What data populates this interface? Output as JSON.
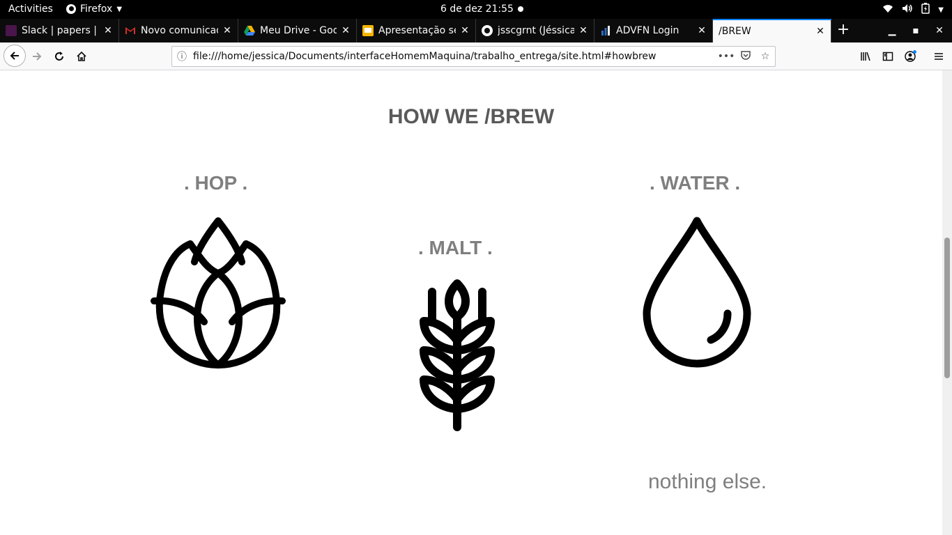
{
  "topbar": {
    "activities": "Activities",
    "app_name": "Firefox",
    "clock": "6 de dez  21:55"
  },
  "tabs": [
    {
      "title": "Slack | papers | C",
      "icon": "slack-icon",
      "color": "#4a154b"
    },
    {
      "title": "Novo comunicad",
      "icon": "gmail-icon",
      "color": "#d93025"
    },
    {
      "title": "Meu Drive - Goo",
      "icon": "drive-icon",
      "color": "#1fa463"
    },
    {
      "title": "Apresentação se",
      "icon": "slides-icon",
      "color": "#f4b400"
    },
    {
      "title": "jsscgrnt (Jéssica",
      "icon": "github-icon",
      "color": "#f9f9fa"
    },
    {
      "title": "ADVFN Login",
      "icon": "advfn-icon",
      "color": "#2d6cc0"
    },
    {
      "title": "/BREW",
      "icon": "",
      "color": ""
    }
  ],
  "navbar": {
    "url": "file:///home/jessica/Documents/interfaceHomemMaquina/trabalho_entrega/site.html#howbrew"
  },
  "page": {
    "section_title": "HOW WE /BREW",
    "hop_label": ". HOP .",
    "malt_label": ". MALT .",
    "water_label": ". WATER .",
    "tagline": "nothing else."
  },
  "colors": {
    "heading": "#595959",
    "label": "#7f7f7f",
    "icon": "#000000",
    "tab_accent": "#0a84ff"
  }
}
